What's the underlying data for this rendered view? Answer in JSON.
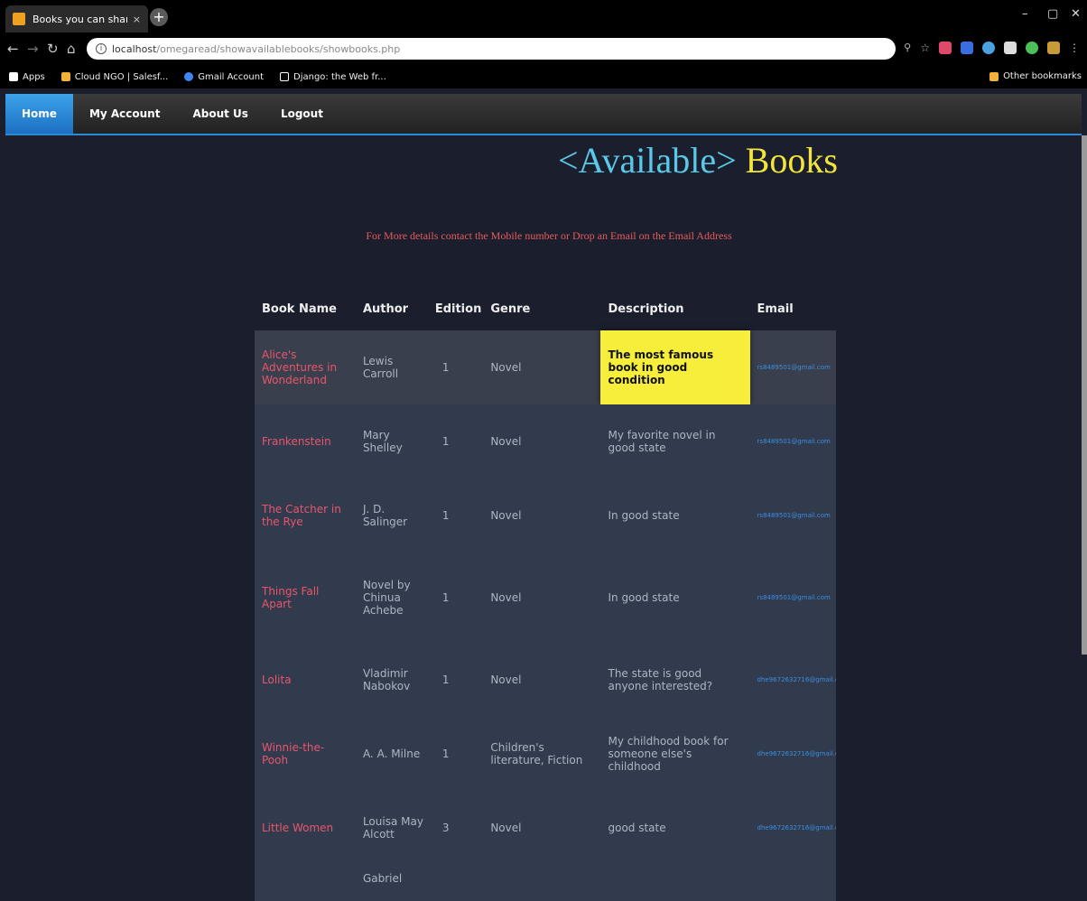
{
  "browser": {
    "tab_title": "Books you can share with",
    "tab_close": "×",
    "new_tab": "+",
    "url_host": "localhost",
    "url_path": "/omegaread/showavailablebooks/showbooks.php",
    "bookmarks": [
      {
        "label": "Apps",
        "icon": "apps-grid-icon",
        "color": "#ffffff"
      },
      {
        "label": "Cloud NGO | Salesf...",
        "icon": "salesforce-icon",
        "color": "#f3b13a"
      },
      {
        "label": "Gmail Account",
        "icon": "google-icon",
        "color": "#4285f4"
      },
      {
        "label": "Django: the Web fr...",
        "icon": "page-icon",
        "color": "#ffffff"
      }
    ],
    "other_bookmarks": "Other bookmarks"
  },
  "nav": {
    "items": [
      "Home",
      "My Account",
      "About Us",
      "Logout"
    ],
    "active": "Home"
  },
  "page": {
    "title_part1": "<Available>",
    "title_part2": "Books",
    "notice": "For More details contact the Mobile number or Drop an Email on the Email Address"
  },
  "table": {
    "headers": [
      "Book Name",
      "Author",
      "Edition",
      "Genre",
      "Description",
      "Email"
    ],
    "rows": [
      {
        "name": "Alice's Adventures in Wonderland",
        "author": "Lewis Carroll",
        "edition": "1",
        "genre": "Novel",
        "description": "The most famous book in good condition",
        "email": "rs8489501@gmail.com",
        "highlighted": true
      },
      {
        "name": "Frankenstein",
        "author": "Mary Shelley",
        "edition": "1",
        "genre": "Novel",
        "description": "My favorite novel in good state",
        "email": "rs8489501@gmail.com"
      },
      {
        "name": "The Catcher in the Rye",
        "author": "J. D. Salinger",
        "edition": "1",
        "genre": "Novel",
        "description": "In good state",
        "email": "rs8489501@gmail.com"
      },
      {
        "name": "Things Fall Apart",
        "author": "Novel by Chinua Achebe",
        "edition": "1",
        "genre": "Novel",
        "description": "In good state",
        "email": "rs8489501@gmail.com"
      },
      {
        "name": "Lolita",
        "author": "Vladimir Nabokov",
        "edition": "1",
        "genre": "Novel",
        "description": "The state is good anyone interested?",
        "email": "dhe9672632716@gmail.c"
      },
      {
        "name": "Winnie-the-Pooh",
        "author": "A. A. Milne",
        "edition": "1",
        "genre": "Children's literature, Fiction",
        "description": "My childhood book for someone else's childhood",
        "email": "dhe9672632716@gmail.c"
      },
      {
        "name": "Little Women",
        "author": "Louisa May Alcott",
        "edition": "3",
        "genre": "Novel",
        "description": "good state",
        "email": "dhe9672632716@gmail.c"
      },
      {
        "name": "",
        "author": "Gabriel",
        "edition": "",
        "genre": "",
        "description": "",
        "email": ""
      }
    ]
  },
  "colors": {
    "accent": "#2a8ad4",
    "book_name": "#e8566b",
    "email": "#3a8fe0",
    "highlight": "#f6ee3a"
  }
}
